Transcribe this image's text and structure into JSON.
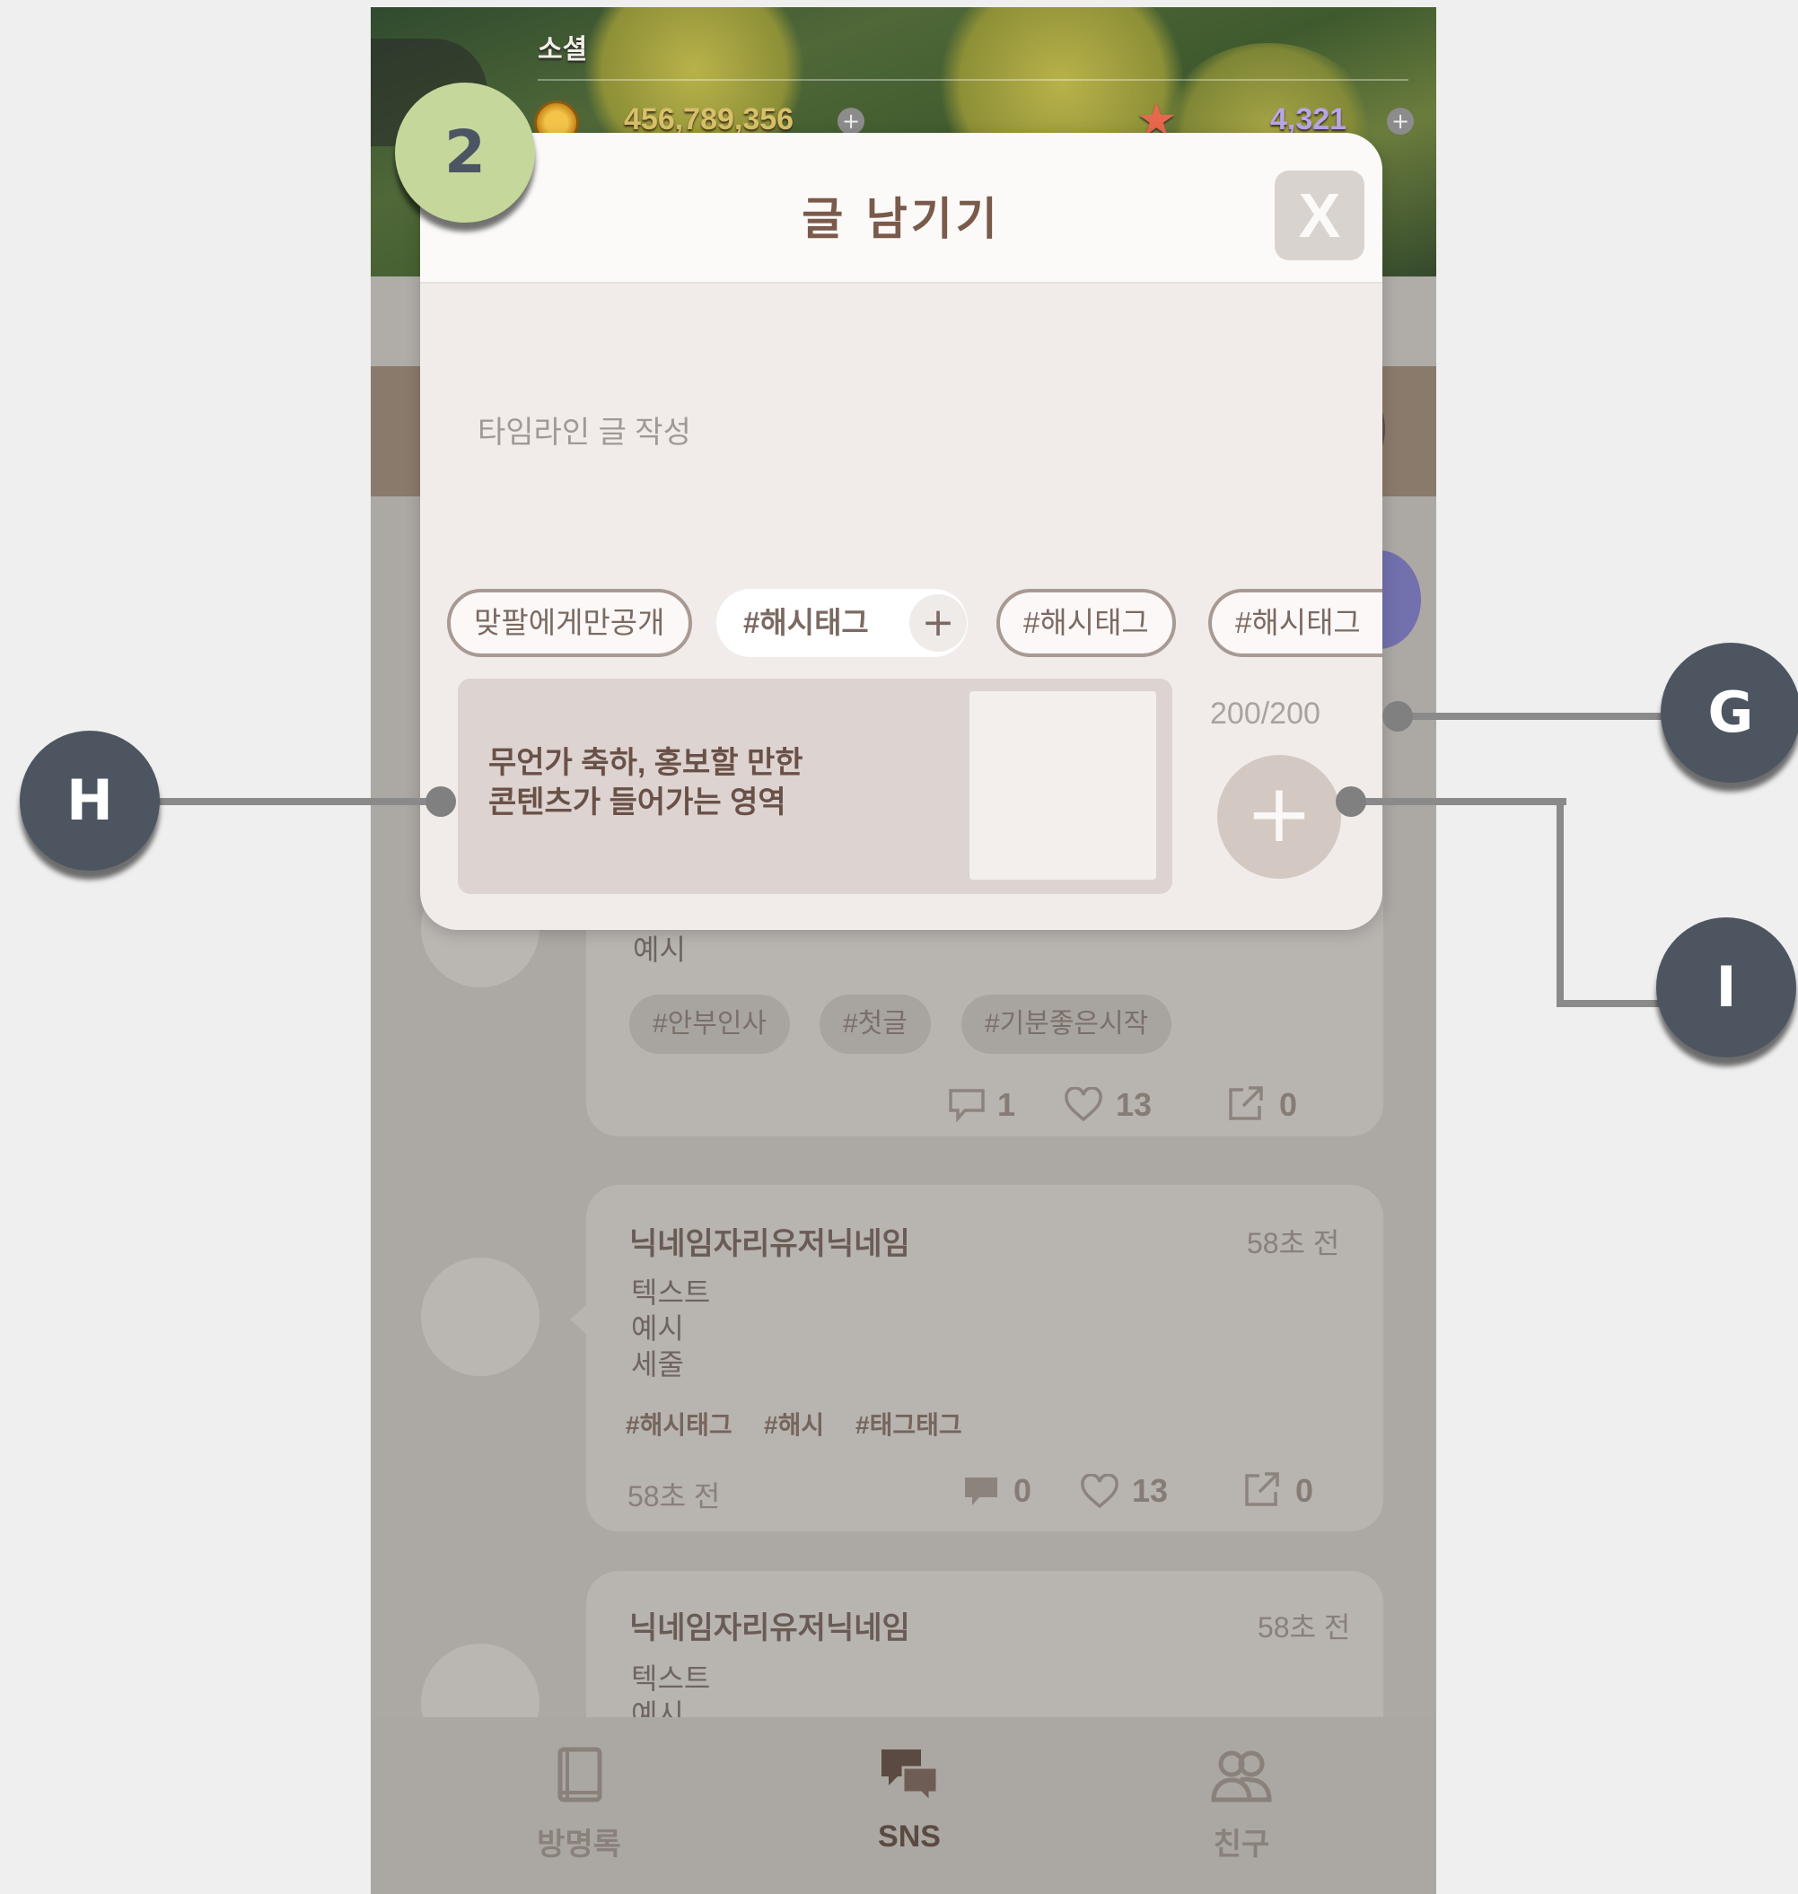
{
  "header": {
    "title": "소셜",
    "gold": "456,789,356",
    "stars": "4,321",
    "plus": "+"
  },
  "dialog": {
    "title": "글 남기기",
    "close": "X",
    "placeholder": "타임라인 글 작성",
    "visibility_pill": "맞팔에게만공개",
    "tag_input": "#해시태그",
    "tag_add": "+",
    "tags": [
      "#해시태그",
      "#해시태그"
    ],
    "promo_line1": "무언가 축하, 홍보할 만한",
    "promo_line2": "콘텐츠가 들어가는 영역",
    "counter": "200/200",
    "add_button": "+"
  },
  "feed": {
    "card1": {
      "body_tail": "예시",
      "chips": [
        "#안부인사",
        "#첫글",
        "#기분좋은시작"
      ],
      "comments": "1",
      "likes": "13",
      "shares": "0"
    },
    "card2": {
      "nickname": "닉네임자리유저닉네임",
      "time": "58초 전",
      "lines": [
        "텍스트",
        "예시",
        "세줄"
      ],
      "hashtags": [
        "#해시태그",
        "#해시",
        "#태그태그"
      ],
      "time_bottom": "58초 전",
      "comments": "0",
      "likes": "13",
      "shares": "0"
    },
    "card3": {
      "nickname": "닉네임자리유저닉네임",
      "time": "58초 전",
      "lines": [
        "텍스트",
        "예시"
      ]
    }
  },
  "nav": {
    "items": [
      {
        "label": "방명록",
        "icon": "book-icon"
      },
      {
        "label": "SNS",
        "icon": "chat-bubbles-icon"
      },
      {
        "label": "친구",
        "icon": "friends-icon"
      }
    ]
  },
  "annotations": {
    "step": "2",
    "g": "G",
    "h": "H",
    "i": "I"
  },
  "colors": {
    "marker_dark": "#4d5561",
    "marker_step": "#c6d79b",
    "dialog_bg": "#f1ecea",
    "title_brown": "#7a5a4a"
  }
}
